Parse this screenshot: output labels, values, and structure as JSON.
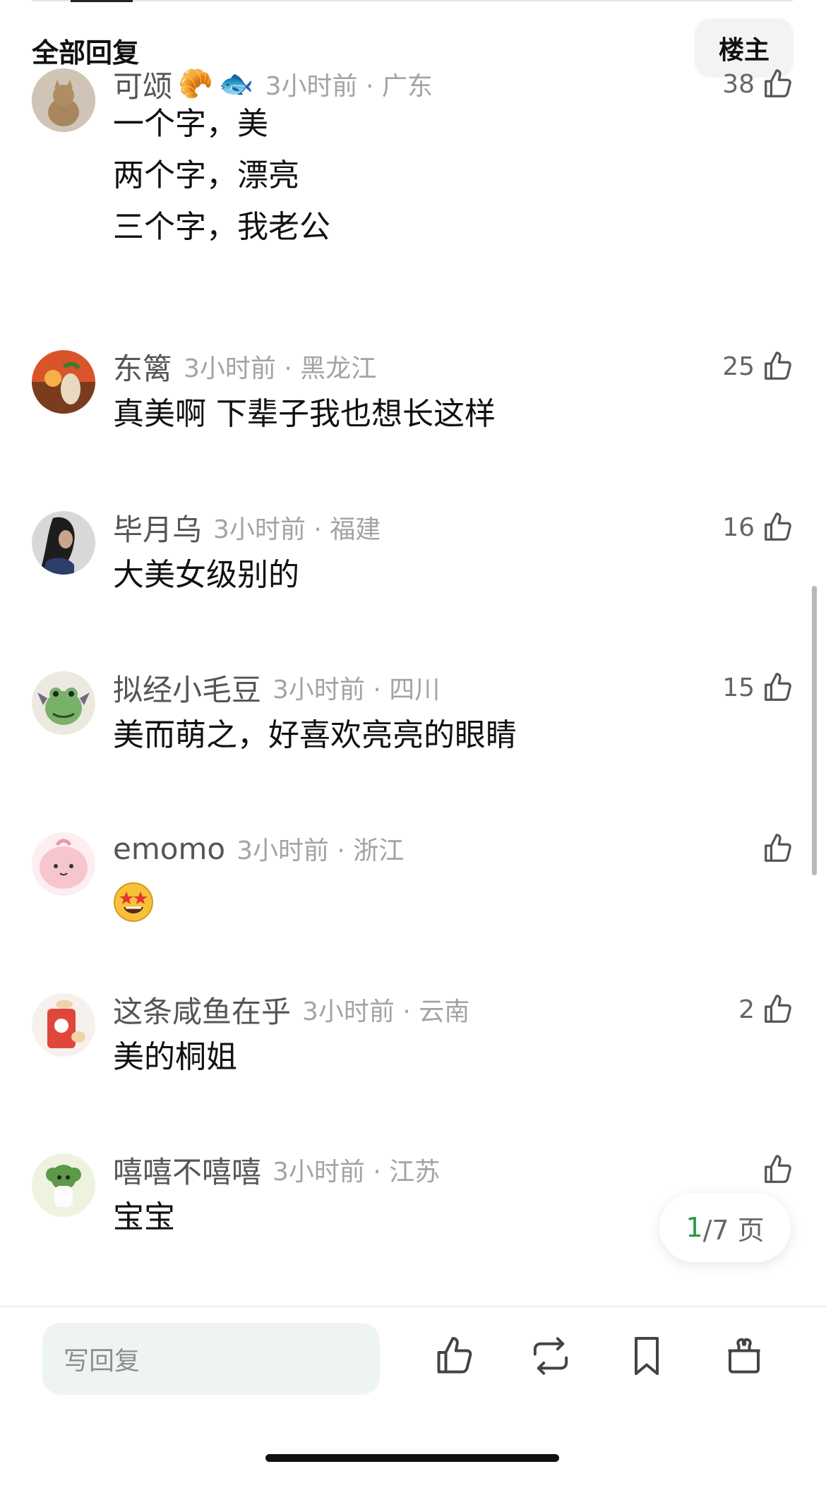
{
  "header": {
    "title": "全部回复",
    "owner_button": "楼主"
  },
  "comments": [
    {
      "name": "可颂",
      "badges": [
        "🥐",
        "🐟"
      ],
      "time": "3小时前 · 广东",
      "likes": "38",
      "lines": [
        "一个字，美",
        "两个字，漂亮",
        "三个字，我老公"
      ],
      "avatar": "cat-avatar"
    },
    {
      "name": "东篱",
      "time": "3小时前 · 黑龙江",
      "likes": "25",
      "lines": [
        "真美啊 下辈子我也想长这样"
      ],
      "avatar": "sunset-avatar"
    },
    {
      "name": "毕月乌",
      "time": "3小时前 · 福建",
      "likes": "16",
      "lines": [
        "大美女级别的"
      ],
      "avatar": "portrait-avatar"
    },
    {
      "name": "拟经小毛豆",
      "time": "3小时前 · 四川",
      "likes": "15",
      "lines": [
        "美而萌之，好喜欢亮亮的眼睛"
      ],
      "avatar": "frog-avatar"
    },
    {
      "name": "emomo",
      "time": "3小时前 · 浙江",
      "likes": "",
      "lines": [],
      "emoji": "star-struck-emoji",
      "avatar": "pink-blob-avatar"
    },
    {
      "name": "这条咸鱼在乎",
      "time": "3小时前 · 云南",
      "likes": "2",
      "lines": [
        "美的桐姐"
      ],
      "avatar": "red-pack-avatar"
    },
    {
      "name": "嘻嘻不嘻嘻",
      "time": "3小时前 · 江苏",
      "likes": "",
      "lines": [
        "宝宝"
      ],
      "avatar": "green-creature-avatar"
    }
  ],
  "pager": {
    "current": "1",
    "rest": "/7 页"
  },
  "footer": {
    "reply_placeholder": "写回复",
    "actions": [
      "thumbs-up-icon",
      "repost-icon",
      "bookmark-icon",
      "gift-icon"
    ]
  },
  "colors": {
    "accent_green": "#2e9a45",
    "meta_gray": "#a3a3a3",
    "reply_bg": "#eef5f0"
  }
}
